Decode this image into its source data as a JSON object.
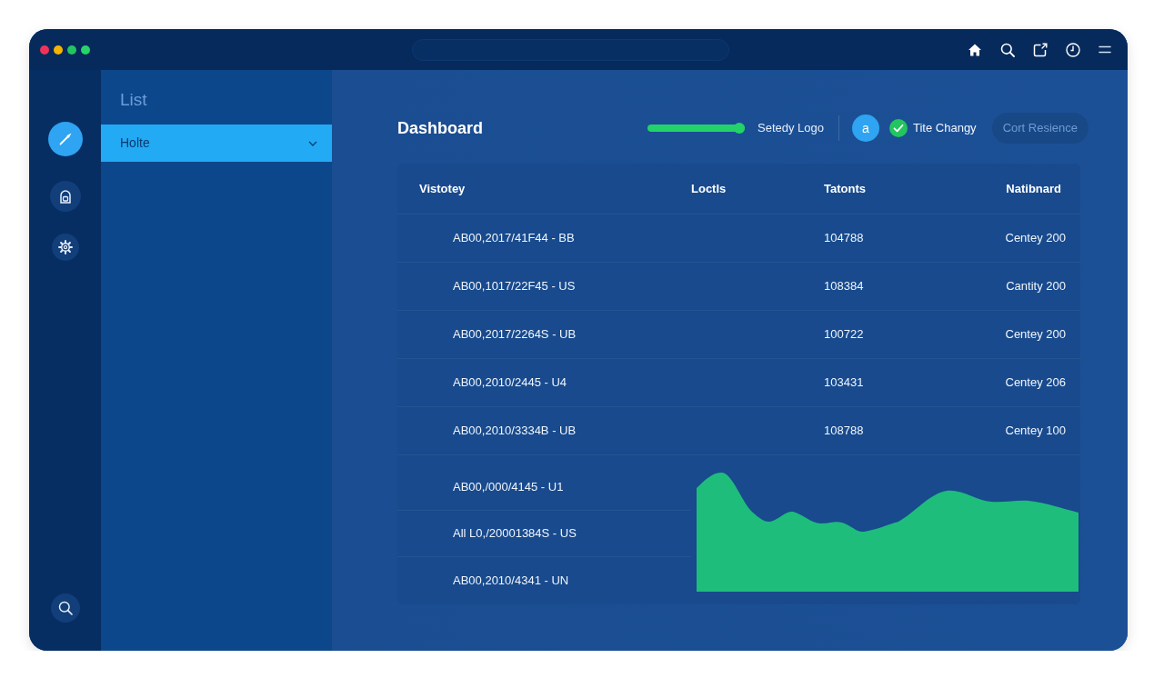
{
  "window": {
    "dots": [
      {
        "color": "#f0325a"
      },
      {
        "color": "#f5b400"
      },
      {
        "color": "#22c55e"
      },
      {
        "color": "#27d46a"
      }
    ]
  },
  "rail": {
    "items": [
      {
        "selected": true
      },
      {
        "selected": false
      },
      {
        "selected": false
      }
    ]
  },
  "sidebar": {
    "title": "List",
    "items": [
      {
        "label": "Holte",
        "selected": true
      }
    ]
  },
  "main": {
    "title": "Dashboard",
    "toolbar": {
      "slider": {
        "level": 1
      },
      "slider_label": "Setedy Logo",
      "avatar": {
        "initial": "a"
      },
      "check": {
        "label": "Tite Changy",
        "checked": true
      },
      "button": {
        "label": "Cort Resience",
        "disabled": true
      }
    },
    "table": {
      "columns": [
        "Vistotey",
        "Loctls",
        "Tatonts",
        "Natibnard"
      ],
      "rows": [
        {
          "column_1": "AB00,2017/41F44 - BB",
          "column_3": "104788",
          "column_4": "Centey 200"
        },
        {
          "column_1": "AB00,1017/22F45 - US",
          "column_3": "108384",
          "column_4": "Cantity 200"
        },
        {
          "column_1": "AB00,2017/2264S - UB",
          "column_3": "100722",
          "column_4": "Centey 200"
        },
        {
          "column_1": "AB00,2010/2445 - U4",
          "column_3": "103431",
          "column_4": "Centey 206"
        },
        {
          "column_1": "AB00,2010/3334B - UB",
          "column_3": "108788",
          "column_4": "Centey 100"
        }
      ],
      "lower_rows": [
        {
          "column_1": "AB00,/000/4145 - U1"
        },
        {
          "column_1": "All L0,/20001384S - US"
        },
        {
          "column_1": "AB00,2010/4341 - UN"
        }
      ]
    }
  }
}
